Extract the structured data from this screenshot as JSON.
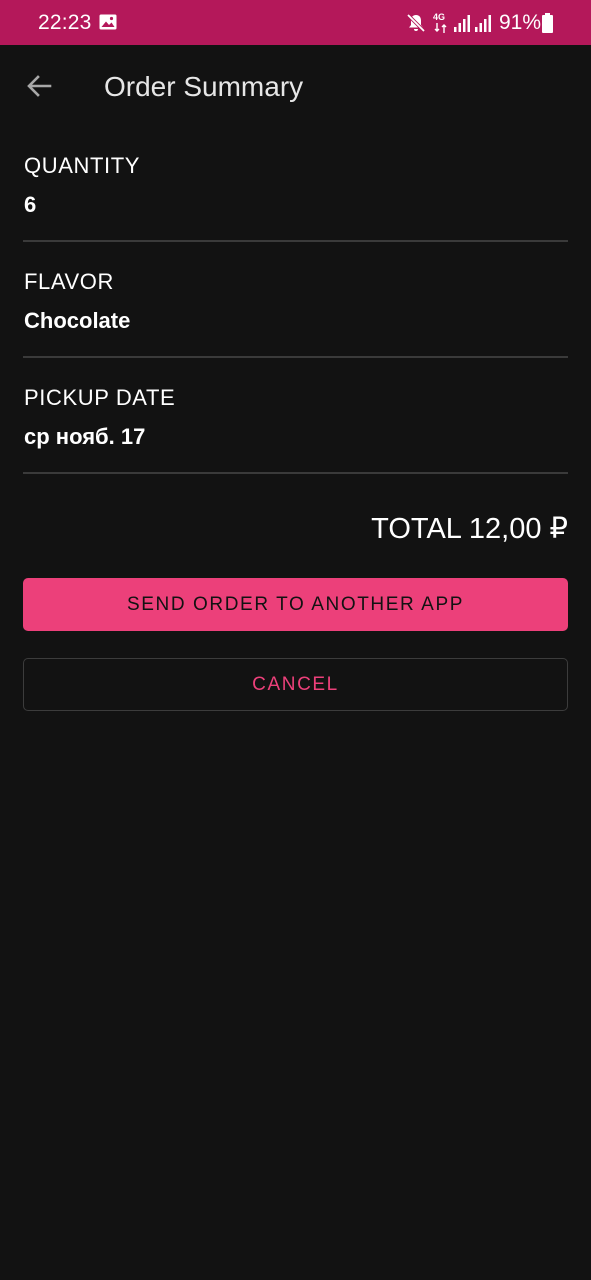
{
  "status_bar": {
    "time": "22:23",
    "network_type": "4G",
    "battery_percent": "91%",
    "background_color": "#b4185a",
    "icons": [
      "gallery-icon",
      "mute-icon",
      "network-4g-icon",
      "signal-icon",
      "signal-icon",
      "battery-icon"
    ]
  },
  "app_bar": {
    "title": "Order Summary",
    "back_icon": "arrow-left-icon"
  },
  "summary": {
    "quantity": {
      "label": "QUANTITY",
      "value": "6"
    },
    "flavor": {
      "label": "FLAVOR",
      "value": "Chocolate"
    },
    "pickup_date": {
      "label": "PICKUP DATE",
      "value": "ср нояб. 17"
    },
    "total": "TOTAL 12,00 ₽"
  },
  "actions": {
    "send_label": "SEND ORDER TO ANOTHER APP",
    "cancel_label": "CANCEL"
  },
  "colors": {
    "background": "#121212",
    "accent": "#ec407a",
    "divider": "#3a3a3a"
  }
}
